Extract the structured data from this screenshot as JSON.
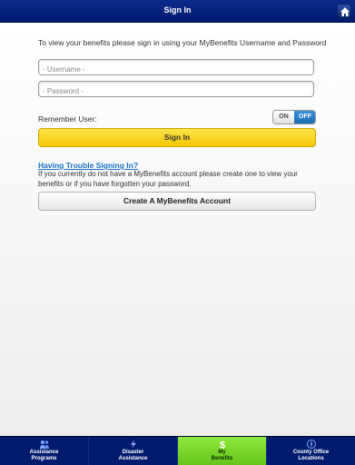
{
  "header": {
    "title": "Sign In"
  },
  "intro_text": "To view your benefits please sign in using your MyBenefits Username and Password",
  "fields": {
    "username_placeholder": "- Username -",
    "password_placeholder": "- Password -"
  },
  "remember": {
    "label": "Remember User:",
    "on_label": "ON",
    "off_label": "OFF",
    "state": "OFF"
  },
  "signin_button": "Sign In",
  "trouble": {
    "link": "Having Trouble Signing In?",
    "text": "If you currently do not have a MyBenefits account please create one to view your benefits or if you have forgotten your password."
  },
  "create_button": "Create A MyBenefits Account",
  "tabs": [
    {
      "line1": "Assistance",
      "line2": "Programs",
      "icon": "people-icon"
    },
    {
      "line1": "Disaster",
      "line2": "Assistance",
      "icon": "lightning-icon"
    },
    {
      "line1": "My",
      "line2": "Benefits",
      "icon": "dollar-icon",
      "active": true
    },
    {
      "line1": "County Office",
      "line2": "Locations",
      "icon": "compass-icon"
    }
  ],
  "colors": {
    "header_bg": "#001a6e",
    "signin_button": "#f3c700",
    "active_tab": "#66c31a",
    "link": "#1a72c9",
    "toggle_off": "#1c6cb8"
  }
}
